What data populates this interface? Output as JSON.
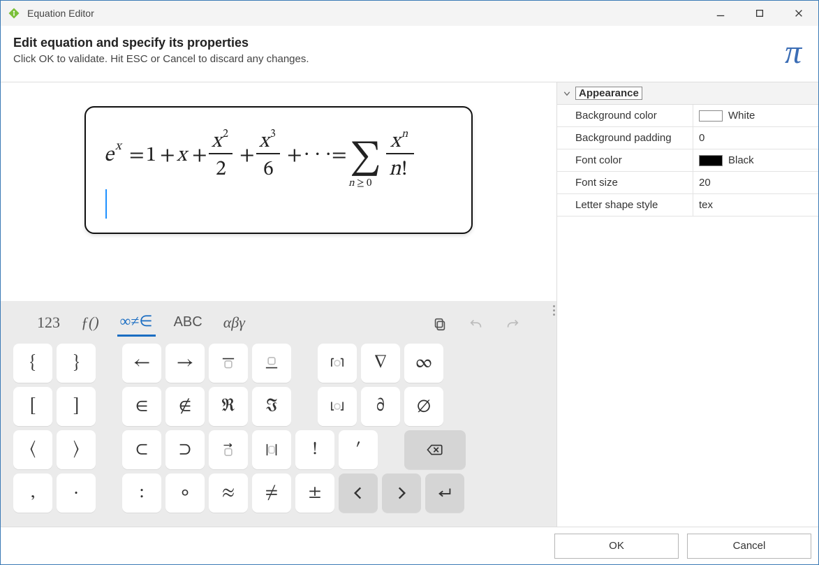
{
  "window": {
    "title": "Equation Editor"
  },
  "header": {
    "heading": "Edit equation and specify its properties",
    "subheading": "Click OK to validate. Hit ESC or Cancel to discard any changes.",
    "pi_glyph": "π"
  },
  "equation_latex": "e^{x} = 1 + x + \\frac{x^{2}}{2} + \\frac{x^{3}}{6} + \\cdots = \\sum_{n\\ge 0} \\frac{x^{n}}{n!}",
  "tabs": {
    "t123": "123",
    "fn": "ƒ()",
    "inf": "∞≠∈",
    "abc": "ABC",
    "greek": "αβγ"
  },
  "properties": {
    "group_label": "Appearance",
    "rows": {
      "bgcolor_label": "Background color",
      "bgcolor_value": "White",
      "bgpad_label": "Background padding",
      "bgpad_value": "0",
      "fontcolor_label": "Font color",
      "fontcolor_value": "Black",
      "fontsize_label": "Font size",
      "fontsize_value": "20",
      "letter_label": "Letter shape style",
      "letter_value": "tex"
    }
  },
  "keys": {
    "lbrace": "{",
    "rbrace": "}",
    "larrow": "←",
    "rarrow": "→",
    "overbar": "▔□",
    "underbar": "□▁",
    "ceil": "⌈○⌉",
    "nabla": "∇",
    "infty": "∞",
    "lbracket": "[",
    "rbracket": "]",
    "in": "∈",
    "notin": "∉",
    "re": "ℜ",
    "im": "ℑ",
    "floor": "⌊○⌋",
    "partial": "∂",
    "emptyset": "∅",
    "langle": "⟨",
    "rangle": "⟩",
    "subset": "⊂",
    "supset": "⊃",
    "vec": "□⃗",
    "abs": "|□|",
    "bang": "!",
    "prime": "′",
    "comma": ",",
    "cdot": "·",
    "colon": ":",
    "circ": "∘",
    "approx": "≈",
    "neq": "≠",
    "pm": "±",
    "left": "〈",
    "right": "〉",
    "enter": "↵"
  },
  "footer": {
    "ok": "OK",
    "cancel": "Cancel"
  }
}
